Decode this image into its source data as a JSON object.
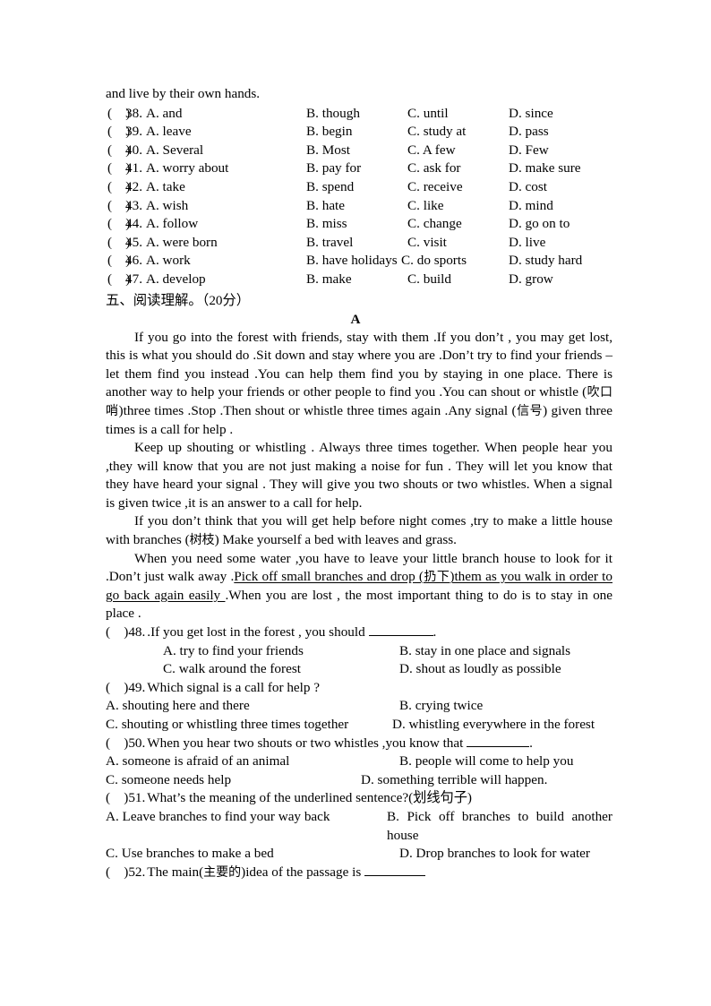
{
  "document": {
    "top_fragment": "and live by their own hands."
  },
  "cloze": {
    "paren": "(",
    "paren_close": ")",
    "items": [
      {
        "num": "38.",
        "a": "A. and",
        "b": "B. though",
        "c": "C. until",
        "d": "D. since"
      },
      {
        "num": "39.",
        "a": "A. leave",
        "b": "B. begin",
        "c": "C. study at",
        "d": "D. pass"
      },
      {
        "num": "40.",
        "a": "A. Several",
        "b": "B. Most",
        "c": "C. A few",
        "d": "D. Few"
      },
      {
        "num": "41.",
        "a": "A. worry about",
        "b": "B. pay for",
        "c": "C. ask for",
        "d": "D. make sure"
      },
      {
        "num": "42.",
        "a": "A. take",
        "b": "B. spend",
        "c": "C. receive",
        "d": "D. cost"
      },
      {
        "num": "43.",
        "a": "A. wish",
        "b": "B. hate",
        "c": "C. like",
        "d": "D. mind"
      },
      {
        "num": "44.",
        "a": "A. follow",
        "b": "B. miss",
        "c": "C. change",
        "d": "D. go on to"
      },
      {
        "num": "45.",
        "a": "A. were born",
        "b": "B. travel",
        "c": "C. visit",
        "d": "D. live"
      },
      {
        "num": "46.",
        "a": "A. work",
        "b": "B. have holidays",
        "c": "C. do sports",
        "d": "D. study hard"
      },
      {
        "num": "47.",
        "a": "A. develop",
        "b": "B. make",
        "c": "C. build",
        "d": "D. grow"
      }
    ]
  },
  "section": {
    "heading_cn": "五、阅读理解。",
    "heading_score": "（20分）",
    "passage_label": "A"
  },
  "passage": {
    "p1_a": "If you go into the forest with friends, stay with them .If you don’t , you may get lost, this is what you should do .Sit down and stay where you are .Don’t try to find your friends –let them find you instead .You can help them find you by staying in one place. There is another way to help your friends or other people to find you .You can shout or whistle (",
    "p1_cn1": "吹口哨",
    "p1_b": ")three times .Stop .Then shout or whistle three times again .Any signal (",
    "p1_cn2": "信号",
    "p1_c": ") given three times is a call for help .",
    "p2": "Keep up shouting or whistling . Always three times together. When people hear you ,they will know that you are not just making a noise for fun . They will let you know that they have heard your signal . They will give you two shouts or two whistles. When a signal is given twice ,it is an answer to a call for help.",
    "p3_a": "If you don’t think that you will get help before night comes ,try to make a little house with branches (",
    "p3_cn": "树枝",
    "p3_b": ") Make yourself a bed with leaves and grass.",
    "p4_a": "When you need some water ,you have to leave your little branch house to look for it .Don’t just walk away .",
    "p4_ul_a": "Pick off   small branches and drop (",
    "p4_ul_cn": "扔下",
    "p4_ul_b": ")them as you walk in order to go back again easily ",
    "p4_b": ".When you are lost , the most important thing to do is to stay in one place ."
  },
  "questions": [
    {
      "paren": "(",
      "paren_close": ")",
      "num": "48.",
      "stem": ".If you get lost in the forest , you should",
      "stem_tail": ".",
      "options": [
        {
          "a": "A. try to find your friends",
          "b": "B. stay in one place and signals"
        },
        {
          "a": "C. walk around the forest",
          "b": "D. shout as loudly as possible"
        }
      ]
    },
    {
      "paren": "(",
      "paren_close": ")",
      "num": "49.",
      "stem": "Which signal  is a call for help ?",
      "options": [
        {
          "a": "A. shouting here and there",
          "b": "B. crying twice"
        },
        {
          "a": "C. shouting or whistling three times together",
          "b": "D.  whistling  everywhere  in  the forest"
        }
      ]
    },
    {
      "paren": "(",
      "paren_close": ")",
      "num": "50.",
      "stem": "When you hear two shouts or two whistles ,you know that",
      "stem_tail": ".",
      "options": [
        {
          "a": "A. someone is afraid of an animal",
          "b": "B. people will come to help you"
        },
        {
          "a": "C. someone needs help",
          "b": "D. something   terrible will happen."
        }
      ]
    },
    {
      "paren": "(",
      "paren_close": ")",
      "num": "51.",
      "stem": "What’s the meaning of the underlined sentence?(划线句子)",
      "options": [
        {
          "a": "A. Leave branches to find your way back",
          "b": "B. Pick off branches to build another house"
        },
        {
          "a": "C. Use branches to make a bed",
          "b": "D. Drop branches to look for water"
        }
      ]
    },
    {
      "paren": "(",
      "paren_close": ")",
      "num": "52.",
      "stem_a": "The main(",
      "stem_cn": "主要的",
      "stem_b": ")idea of the passage   is",
      "stem_tail": ""
    }
  ]
}
